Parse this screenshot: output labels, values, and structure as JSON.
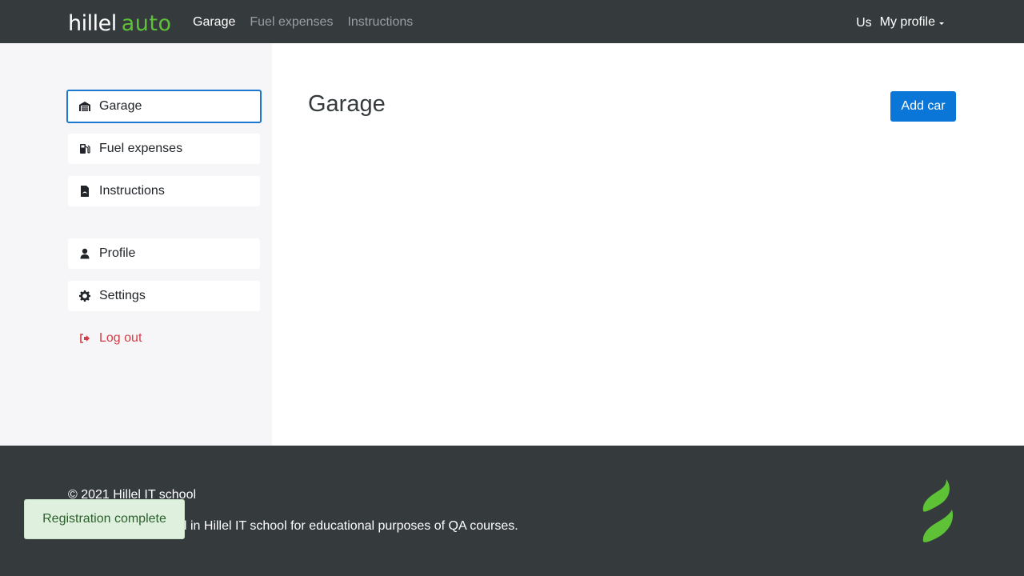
{
  "header": {
    "logo_part1": "hillel",
    "logo_part2": "auto",
    "nav": [
      {
        "label": "Garage"
      },
      {
        "label": "Fuel expenses"
      },
      {
        "label": "Instructions"
      }
    ],
    "user_initials": "Us",
    "profile_label": "My profile"
  },
  "sidebar": {
    "items": [
      {
        "label": "Garage",
        "icon": "garage-icon"
      },
      {
        "label": "Fuel expenses",
        "icon": "fuel-icon"
      },
      {
        "label": "Instructions",
        "icon": "pdf-file-icon"
      },
      {
        "label": "Profile",
        "icon": "user-icon"
      },
      {
        "label": "Settings",
        "icon": "gear-icon"
      },
      {
        "label": "Log out",
        "icon": "logout-icon"
      }
    ]
  },
  "main": {
    "title": "Garage",
    "add_car_label": "Add car"
  },
  "footer": {
    "copyright": "© 2021 Hillel IT school",
    "description": "Hillel auto developed in Hillel IT school for educational purposes of QA courses."
  },
  "toast": {
    "message": "Registration complete"
  },
  "colors": {
    "header_bg": "#353a3d",
    "accent_green": "#5ec236",
    "primary_blue": "#0a76d7",
    "danger_red": "#d23e48"
  }
}
